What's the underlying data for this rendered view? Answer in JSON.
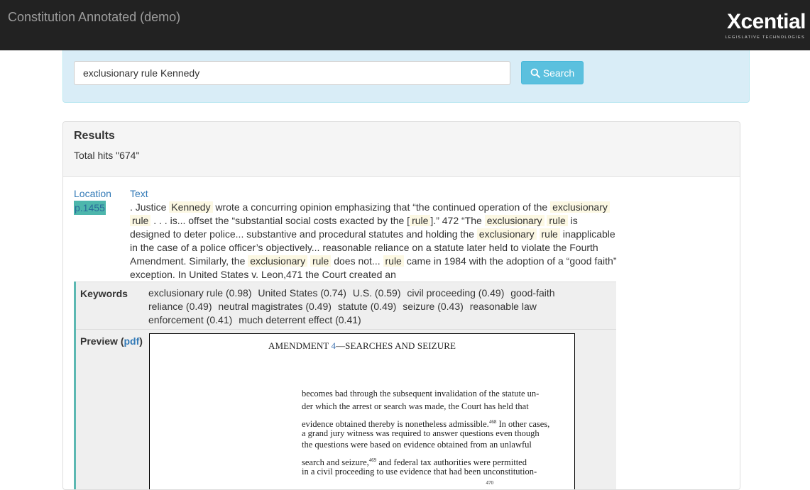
{
  "header": {
    "title": "Constitution Annotated (demo)",
    "logo_word": "Xcential",
    "logo_tagline": "LEGISLATIVE TECHNOLOGIES"
  },
  "search": {
    "query": "exclusionary rule Kennedy",
    "button_label": "Search"
  },
  "results": {
    "heading": "Results",
    "total_hits": "Total hits \"674\"",
    "location_header": "Location",
    "text_header": "Text",
    "hit": {
      "location": "p.1455",
      "snippet": [
        {
          "t": ". Justice ",
          "hl": false
        },
        {
          "t": "Kennedy",
          "hl": true
        },
        {
          "t": " wrote a concurring opinion emphasizing that “the continued operation of the ",
          "hl": false
        },
        {
          "t": "exclusionary",
          "hl": true
        },
        {
          "t": " ",
          "hl": false
        },
        {
          "t": "rule",
          "hl": true
        },
        {
          "t": " . . . is... offset the “substantial social costs exacted by the [",
          "hl": false
        },
        {
          "t": "rule",
          "hl": true
        },
        {
          "t": "].” 472 “The ",
          "hl": false
        },
        {
          "t": "exclusionary",
          "hl": true
        },
        {
          "t": " ",
          "hl": false
        },
        {
          "t": "rule",
          "hl": true
        },
        {
          "t": " is designed to deter police... substantive and procedural statutes and holding the ",
          "hl": false
        },
        {
          "t": "exclusionary",
          "hl": true
        },
        {
          "t": " ",
          "hl": false
        },
        {
          "t": "rule",
          "hl": true
        },
        {
          "t": " inapplicable in the case of a police officer’s objectively... reasonable reliance on a statute later held to violate the Fourth Amendment. Similarly, the ",
          "hl": false
        },
        {
          "t": "exclusionary",
          "hl": true
        },
        {
          "t": " ",
          "hl": false
        },
        {
          "t": "rule",
          "hl": true
        },
        {
          "t": " does not... ",
          "hl": false
        },
        {
          "t": "rule",
          "hl": true
        },
        {
          "t": " came in 1984 with the adoption of a “good faith” exception. In United States v. Leon,471 the Court created an",
          "hl": false
        }
      ],
      "keywords_label": "Keywords",
      "keywords": [
        "exclusionary rule (0.98)",
        "United States (0.74)",
        "U.S. (0.59)",
        "civil proceeding (0.49)",
        "good-faith reliance (0.49)",
        "neutral magistrates (0.49)",
        "statute (0.49)",
        "seizure (0.43)",
        "reasonable law enforcement (0.41)",
        "much deterrent effect (0.41)"
      ],
      "preview_label": "Preview",
      "preview_link": "pdf",
      "pdf": {
        "header_prefix": "AMENDMENT ",
        "header_num": "4",
        "header_suffix": "—SEARCHES AND SEIZURE",
        "lines": [
          "becomes bad through the subsequent invalidation of the statute un-",
          "der which the arrest or search was made, the Court has held that",
          "evidence obtained thereby is nonetheless admissible.",
          "468",
          " In other cases,",
          "a grand jury witness was required to answer questions even though",
          "the questions were based on evidence obtained from an unlawful",
          "search and seizure,",
          "469",
          " and federal tax authorities were permitted",
          "in a civil proceeding to use evidence that had been unconstitution-",
          "470"
        ]
      }
    }
  }
}
